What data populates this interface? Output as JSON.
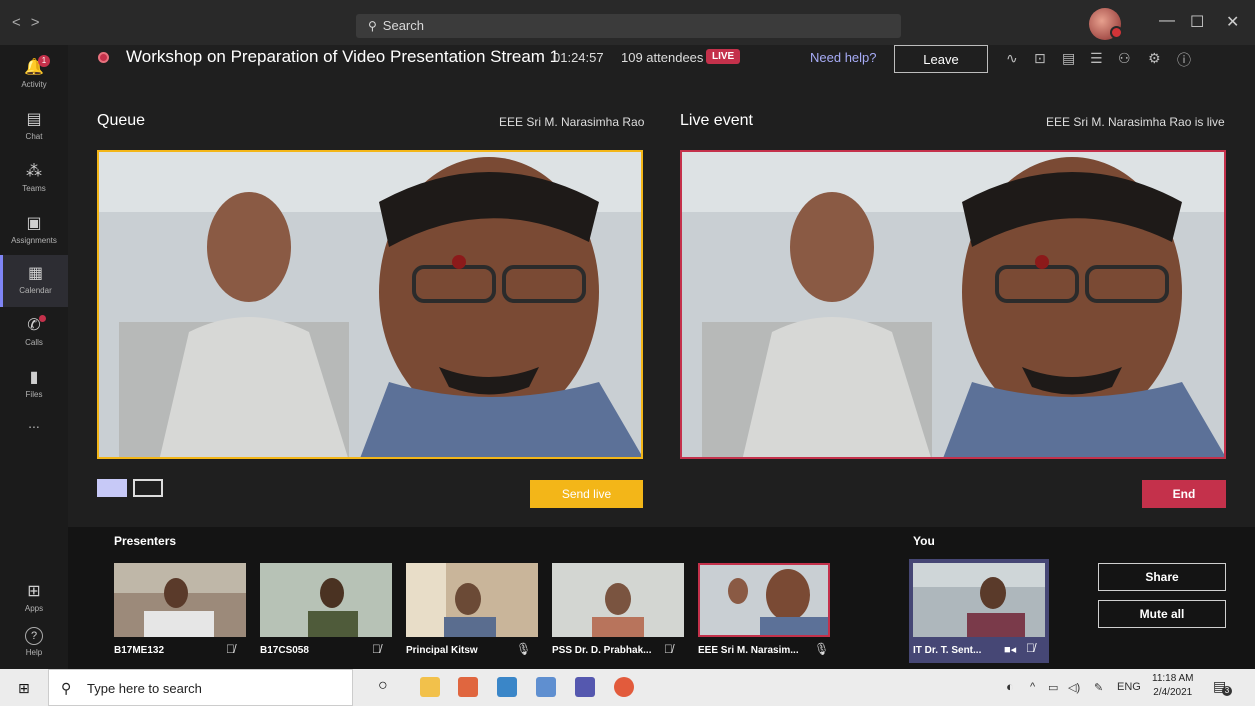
{
  "titlebar": {
    "nav_back": "<",
    "nav_forward": ">",
    "search_label": "Search",
    "minimize": "—",
    "maximize": "☐",
    "close": "✕"
  },
  "rail": {
    "items": [
      {
        "label": "Activity",
        "icon": "bell-icon",
        "glyph": "🔔",
        "badge": "1"
      },
      {
        "label": "Chat",
        "icon": "chat-icon",
        "glyph": "▤"
      },
      {
        "label": "Teams",
        "icon": "teams-icon",
        "glyph": "⁂"
      },
      {
        "label": "Assignments",
        "icon": "assignments-icon",
        "glyph": "▣"
      },
      {
        "label": "Calendar",
        "icon": "calendar-icon",
        "glyph": "▦"
      },
      {
        "label": "Calls",
        "icon": "phone-icon",
        "glyph": "✆"
      },
      {
        "label": "Files",
        "icon": "files-icon",
        "glyph": "▮"
      },
      {
        "label": "...",
        "icon": "more-icon",
        "glyph": ""
      },
      {
        "label": "Apps",
        "icon": "apps-icon",
        "glyph": "⊞"
      },
      {
        "label": "Help",
        "icon": "help-icon",
        "glyph": "?"
      }
    ]
  },
  "event": {
    "title": "Workshop on Preparation of Video Presentation Stream 1",
    "elapsed": "01:24:57",
    "attendees": "109 attendees",
    "live_badge": "LIVE",
    "need_help": "Need help?",
    "leave": "Leave"
  },
  "queue": {
    "title": "Queue",
    "presenter": "EEE Sri M. Narasimha Rao",
    "send_live": "Send live"
  },
  "live_event": {
    "title": "Live event",
    "status": "EEE Sri M. Narasimha Rao is live",
    "end": "End"
  },
  "presenters": {
    "label": "Presenters",
    "tiles": [
      {
        "name": "B17ME132",
        "mic": "muted"
      },
      {
        "name": "B17CS058",
        "mic": "muted"
      },
      {
        "name": "Principal Kitsw",
        "mic": "on"
      },
      {
        "name": "PSS Dr. D. Prabhak...",
        "mic": "muted"
      },
      {
        "name": "EEE Sri M. Narasim...",
        "mic": "on"
      }
    ]
  },
  "you": {
    "label": "You",
    "name": "IT Dr. T. Sent...",
    "share": "Share",
    "mute_all": "Mute all"
  },
  "taskbar": {
    "search_placeholder": "Type here to search",
    "lang": "ENG",
    "time": "11:18 AM",
    "date": "2/4/2021",
    "notifications": "3"
  },
  "colors": {
    "accent": "#7f85f5",
    "queue_border": "#f3b618",
    "live_red": "#c4314b",
    "background": "#1f1f1f"
  }
}
